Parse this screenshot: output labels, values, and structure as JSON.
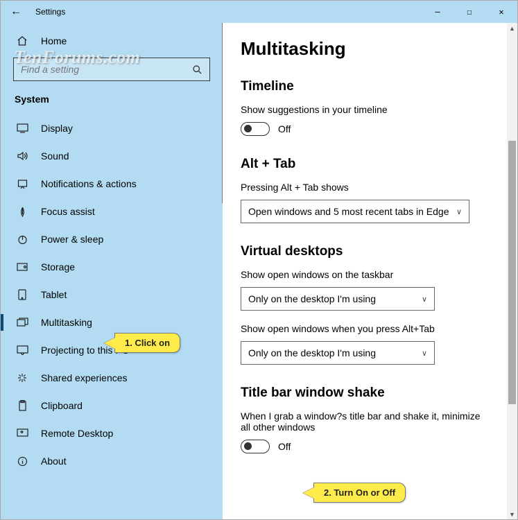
{
  "window": {
    "title": "Settings"
  },
  "watermark": "TenForums.com",
  "sidebar": {
    "home_label": "Home",
    "search_placeholder": "Find a setting",
    "section_label": "System",
    "items": [
      {
        "label": "Display"
      },
      {
        "label": "Sound"
      },
      {
        "label": "Notifications & actions"
      },
      {
        "label": "Focus assist"
      },
      {
        "label": "Power & sleep"
      },
      {
        "label": "Storage"
      },
      {
        "label": "Tablet"
      },
      {
        "label": "Multitasking"
      },
      {
        "label": "Projecting to this PC"
      },
      {
        "label": "Shared experiences"
      },
      {
        "label": "Clipboard"
      },
      {
        "label": "Remote Desktop"
      },
      {
        "label": "About"
      }
    ]
  },
  "page": {
    "title": "Multitasking",
    "timeline": {
      "heading": "Timeline",
      "label": "Show suggestions in your timeline",
      "state": "Off"
    },
    "alttab": {
      "heading": "Alt + Tab",
      "label": "Pressing Alt + Tab shows",
      "value": "Open windows and 5 most recent tabs in Edge"
    },
    "virtdesk": {
      "heading": "Virtual desktops",
      "label1": "Show open windows on the taskbar",
      "value1": "Only on the desktop I'm using",
      "label2": "Show open windows when you press Alt+Tab",
      "value2": "Only on the desktop I'm using"
    },
    "shake": {
      "heading": "Title bar window shake",
      "label": "When I grab a window?s title bar and shake it, minimize all other windows",
      "state": "Off"
    }
  },
  "callouts": {
    "c1": "1. Click on",
    "c2": "2. Turn On or Off"
  }
}
